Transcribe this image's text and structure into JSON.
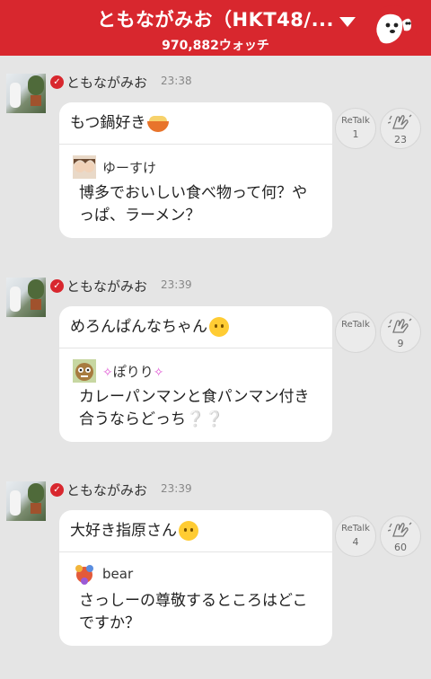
{
  "header": {
    "title": "ともながみお（HKT48/...",
    "watch_count": "970,882ウォッチ"
  },
  "messages": [
    {
      "author": "ともながみお",
      "time": "23:38",
      "talk": "もつ鍋好き",
      "talk_emoji": "ramen-bowl-icon",
      "question_author": "ゆーすけ",
      "question": "博多でおいしい食べ物って何？やっぱ、ラーメン？",
      "retalk_label": "ReTalk",
      "retalk_count": "1",
      "clap_count": "23"
    },
    {
      "author": "ともながみお",
      "time": "23:39",
      "talk": "めろんぱんなちゃん",
      "talk_emoji": "smiley-face-icon",
      "question_author": "ぽりり",
      "question": "カレーパンマンと食パンマン付き合うならどっち❔❔",
      "retalk_label": "ReTalk",
      "retalk_count": "",
      "clap_count": "9"
    },
    {
      "author": "ともながみお",
      "time": "23:39",
      "talk": "大好き指原さん",
      "talk_emoji": "smiley-face-icon",
      "question_author": "bear",
      "question": "さっしーの尊敬するところはどこですか？",
      "retalk_label": "ReTalk",
      "retalk_count": "4",
      "clap_count": "60"
    }
  ]
}
